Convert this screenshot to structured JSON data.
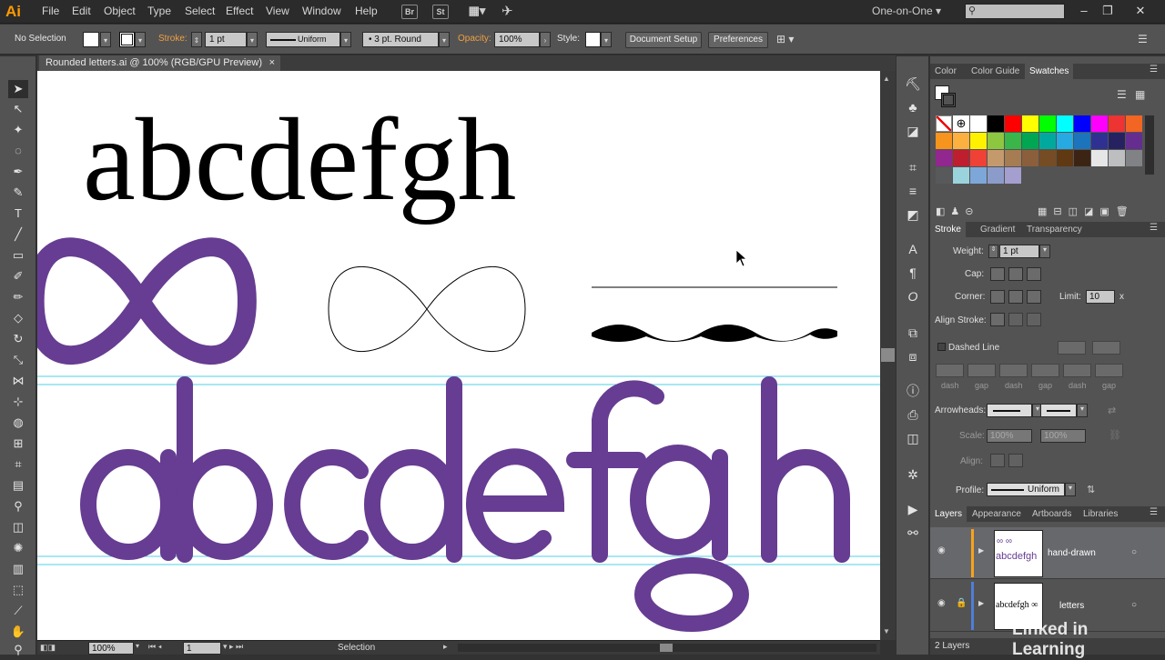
{
  "app": {
    "logo": "Ai",
    "workspace": "One-on-One",
    "bridge_label": "Br",
    "stock_label": "St"
  },
  "menu": [
    "File",
    "Edit",
    "Object",
    "Type",
    "Select",
    "Effect",
    "View",
    "Window",
    "Help"
  ],
  "controlbar": {
    "selection": "No Selection",
    "stroke_label": "Stroke:",
    "stroke_weight": "1 pt",
    "profile": "Uniform",
    "brush": "3 pt. Round",
    "opacity_label": "Opacity:",
    "opacity": "100%",
    "style_label": "Style:",
    "doc_setup": "Document Setup",
    "preferences": "Preferences"
  },
  "document": {
    "tab_title": "Rounded letters.ai @ 100% (RGB/GPU Preview)",
    "close": "×"
  },
  "canvas": {
    "serif_letters": "abcdefgh",
    "infinity": "∞",
    "colors": {
      "purple": "#663d92",
      "black": "#000000"
    }
  },
  "statusbar": {
    "zoom": "100%",
    "artboard": "1",
    "tool": "Selection"
  },
  "swatch_panel": {
    "tabs": [
      "Color",
      "Color Guide",
      "Swatches"
    ],
    "active": "Swatches",
    "swatches": [
      "#ffffff",
      "#000000",
      "#ff0000",
      "#ffff00",
      "#00ff00",
      "#00ffff",
      "#0000ff",
      "#ff00ff",
      "#ee3333",
      "#f26522",
      "#f7941d",
      "#fbb040",
      "#fff200",
      "#8dc63f",
      "#39b54a",
      "#00a651",
      "#00a99d",
      "#27aae1",
      "#1c75bc",
      "#2e3192",
      "#262262",
      "#662d91",
      "#92278f",
      "#be1e2d",
      "#ef4136",
      "#c49a6c",
      "#a67c52",
      "#8b5e3c",
      "#754c24",
      "#603913",
      "#3c2415",
      "#e6e6e6",
      "#bcbec0",
      "#808285",
      "#58595b",
      "#9bd3dd",
      "#7da7d9",
      "#8c9cca",
      "#a49fcf"
    ]
  },
  "stroke_panel": {
    "tabs": [
      "Stroke",
      "Gradient",
      "Transparency"
    ],
    "weight_label": "Weight:",
    "weight": "1 pt",
    "cap_label": "Cap:",
    "corner_label": "Corner:",
    "limit_label": "Limit:",
    "limit": "10",
    "limit_unit": "x",
    "align_label": "Align Stroke:",
    "dashed_line": "Dashed Line",
    "dash_labels": [
      "dash",
      "gap",
      "dash",
      "gap",
      "dash",
      "gap"
    ],
    "arrowheads_label": "Arrowheads:",
    "scale_label": "Scale:",
    "scale1": "100%",
    "scale2": "100%",
    "align2_label": "Align:",
    "profile_label": "Profile:",
    "profile": "Uniform"
  },
  "layers_panel": {
    "tabs": [
      "Layers",
      "Appearance",
      "Artboards",
      "Libraries"
    ],
    "layers": [
      {
        "name": "hand-drawn",
        "color": "#f7a21b",
        "thumb": "abcdefgh"
      },
      {
        "name": "letters",
        "color": "#4f7fd8",
        "thumb": "abcdefgh ∞"
      }
    ],
    "count": "2 Layers"
  },
  "watermark": "Linked in Learning"
}
